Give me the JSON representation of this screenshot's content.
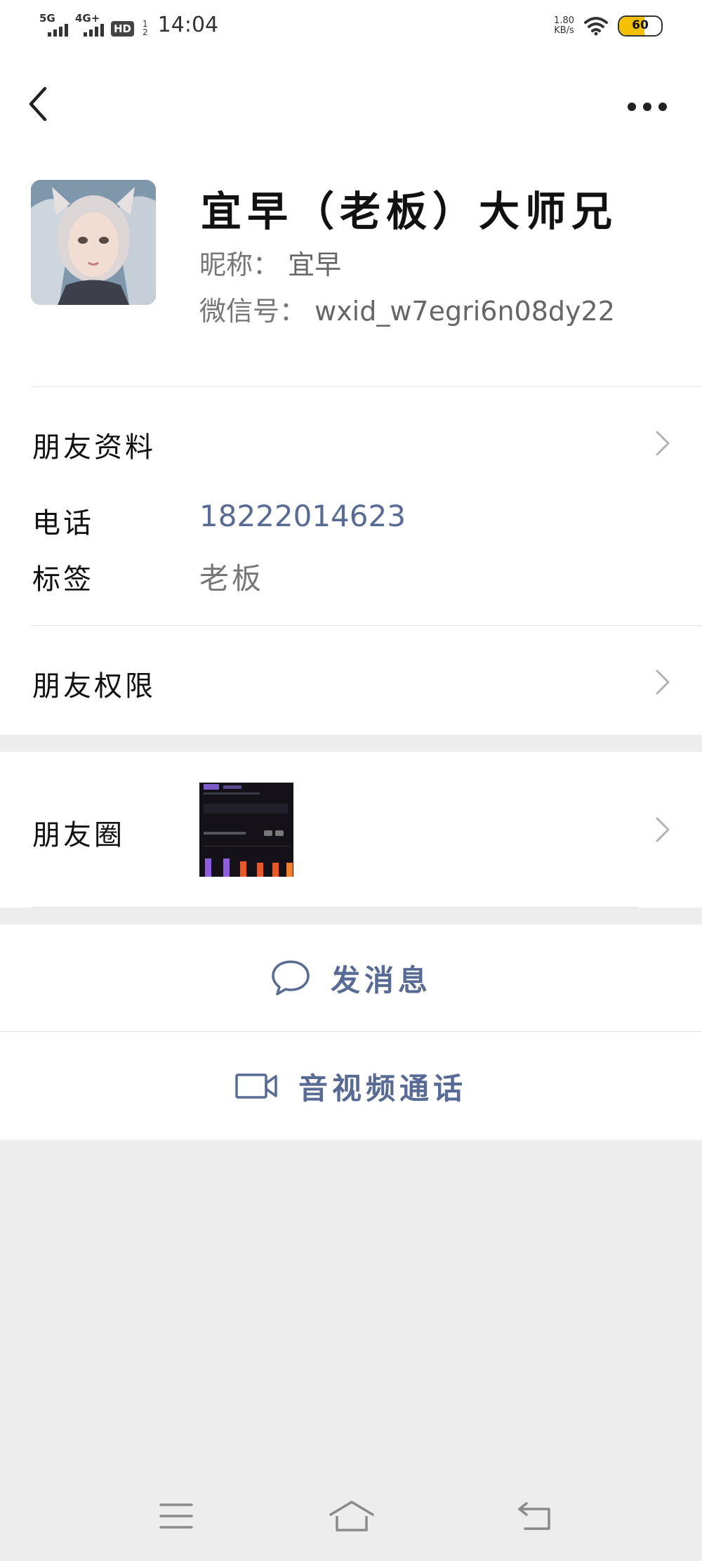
{
  "status_bar": {
    "sim1": "5G",
    "sim2": "4G+",
    "hd": "HD",
    "hd_sub_top": "1",
    "hd_sub_bottom": "2",
    "time": "14:04",
    "speed_value": "1.80",
    "speed_unit": "KB/s",
    "battery": "60",
    "battery_level": 0.6,
    "battery_color": "#f5c000"
  },
  "profile": {
    "display_name": "宜早（老板）大师兄",
    "nickname_label": "昵称：",
    "nickname": "宜早",
    "wechat_id_label": "微信号：",
    "wechat_id": "wxid_w7egri6n08dy22"
  },
  "rows": {
    "friend_profile": "朋友资料",
    "phone_label": "电话",
    "phone_value": "18222014623",
    "tag_label": "标签",
    "tag_value": "老板",
    "friend_permission": "朋友权限",
    "moments": "朋友圈"
  },
  "actions": {
    "message": "发消息",
    "video_call": "音视频通话"
  },
  "colors": {
    "link_blue": "#576b95",
    "background": "#ededed"
  },
  "icons": {
    "back": "back-arrow-icon",
    "more": "more-dots-icon",
    "chevron": "chevron-right-icon",
    "message": "chat-bubble-icon",
    "video": "video-camera-icon",
    "menu": "menu-icon",
    "home": "home-icon",
    "return": "return-icon"
  }
}
